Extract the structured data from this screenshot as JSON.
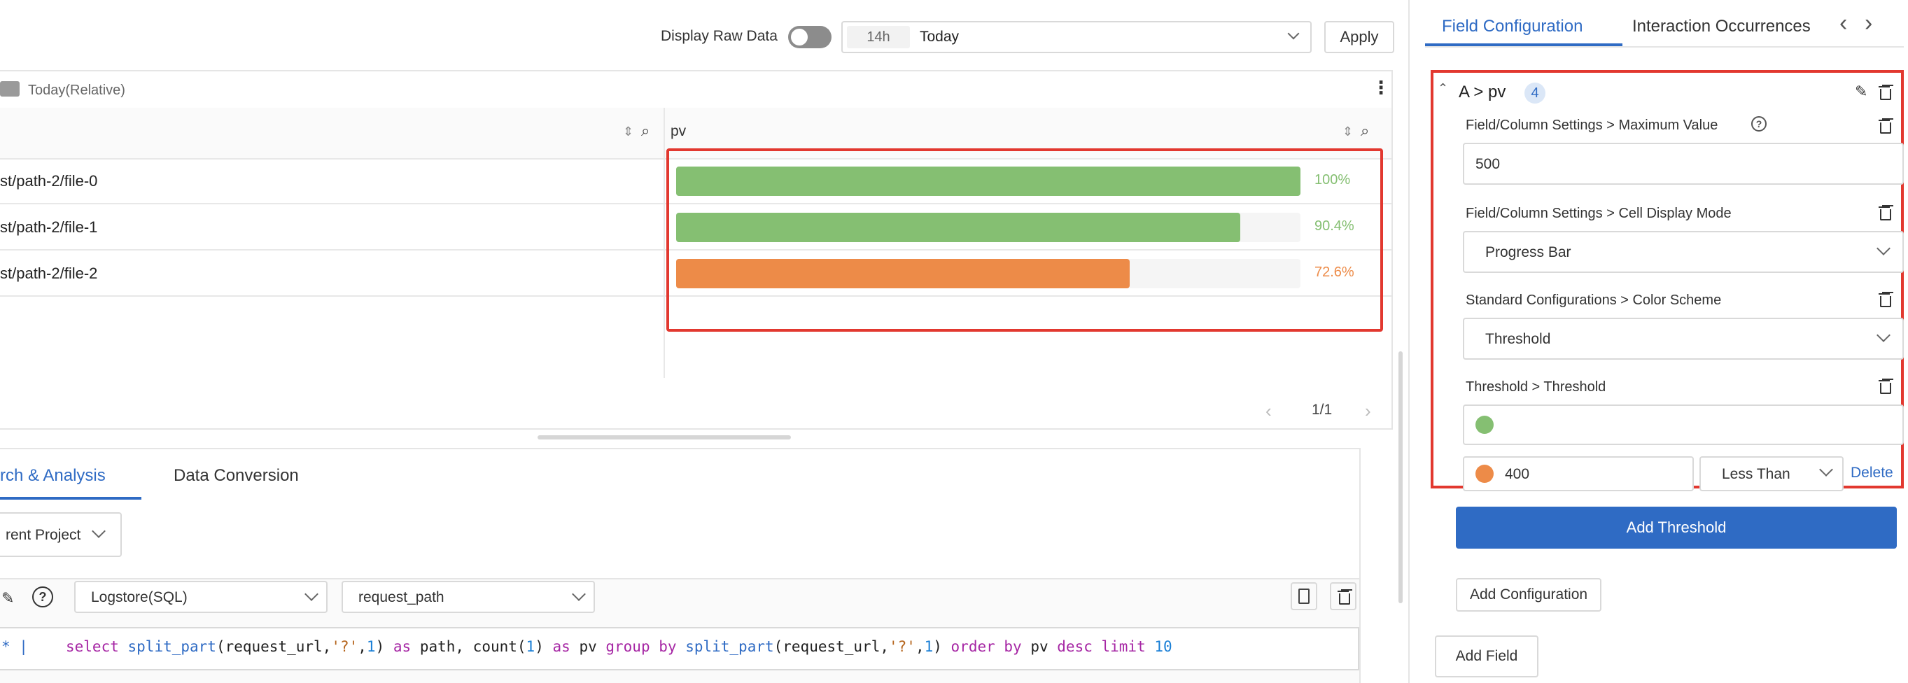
{
  "toolbar": {
    "display_raw_data_label": "Display Raw Data",
    "time_shortcut": "14h",
    "time_value": "Today",
    "apply_label": "Apply"
  },
  "panel": {
    "title": "Today(Relative)",
    "columns": [
      "",
      "pv"
    ],
    "rows": [
      {
        "path": "st/path-2/file-0",
        "percent_label": "100%",
        "fraction": 1.0,
        "color": "#85bf72"
      },
      {
        "path": "st/path-2/file-1",
        "percent_label": "90.4%",
        "fraction": 0.904,
        "color": "#85bf72"
      },
      {
        "path": "st/path-2/file-2",
        "percent_label": "72.6%",
        "fraction": 0.726,
        "color": "#ed8b48"
      }
    ],
    "pagination": "1/1"
  },
  "query": {
    "tabs": [
      "rch & Analysis",
      "Data Conversion"
    ],
    "project": "rent Project",
    "logstore": "Logstore(SQL)",
    "field": "request_path",
    "prefix": "* |",
    "sql_tokens": [
      {
        "t": "select ",
        "c": "kw"
      },
      {
        "t": "split_part",
        "c": "fn"
      },
      {
        "t": "(request_url,",
        "c": "tx"
      },
      {
        "t": "'?'",
        "c": "st"
      },
      {
        "t": ",",
        "c": "tx"
      },
      {
        "t": "1",
        "c": "nm"
      },
      {
        "t": ") ",
        "c": "tx"
      },
      {
        "t": "as",
        "c": "kw"
      },
      {
        "t": " path, count(",
        "c": "tx"
      },
      {
        "t": "1",
        "c": "nm"
      },
      {
        "t": ") ",
        "c": "tx"
      },
      {
        "t": "as",
        "c": "kw"
      },
      {
        "t": " pv ",
        "c": "tx"
      },
      {
        "t": "group by",
        "c": "kw"
      },
      {
        "t": " ",
        "c": "tx"
      },
      {
        "t": "split_part",
        "c": "fn"
      },
      {
        "t": "(request_url,",
        "c": "tx"
      },
      {
        "t": "'?'",
        "c": "st"
      },
      {
        "t": ",",
        "c": "tx"
      },
      {
        "t": "1",
        "c": "nm"
      },
      {
        "t": ") ",
        "c": "tx"
      },
      {
        "t": "order by",
        "c": "kw"
      },
      {
        "t": " pv ",
        "c": "tx"
      },
      {
        "t": "desc limit",
        "c": "kw"
      },
      {
        "t": " ",
        "c": "tx"
      },
      {
        "t": "10",
        "c": "nm"
      }
    ]
  },
  "right": {
    "tabs": [
      "Field Configuration",
      "Interaction Occurrences"
    ],
    "group_title": "A > pv",
    "group_count": "4",
    "settings": [
      {
        "label": "Field/Column Settings > Maximum Value",
        "value": "500"
      },
      {
        "label": "Field/Column Settings > Cell Display Mode",
        "value": "Progress Bar"
      },
      {
        "label": "Standard Configurations > Color Scheme",
        "value": "Threshold"
      },
      {
        "label": "Threshold > Threshold",
        "value": ""
      }
    ],
    "threshold_base_color": "#85bf72",
    "threshold_color": "#ed8b48",
    "threshold_value": "400",
    "threshold_op": "Less Than",
    "delete_label": "Delete",
    "add_threshold_label": "Add Threshold",
    "add_configuration_label": "Add Configuration",
    "add_field_label": "Add Field"
  },
  "colors": {
    "accent": "#2f6bc4",
    "highlight_red": "#e2382f",
    "green": "#85bf72",
    "orange": "#ed8b48"
  }
}
